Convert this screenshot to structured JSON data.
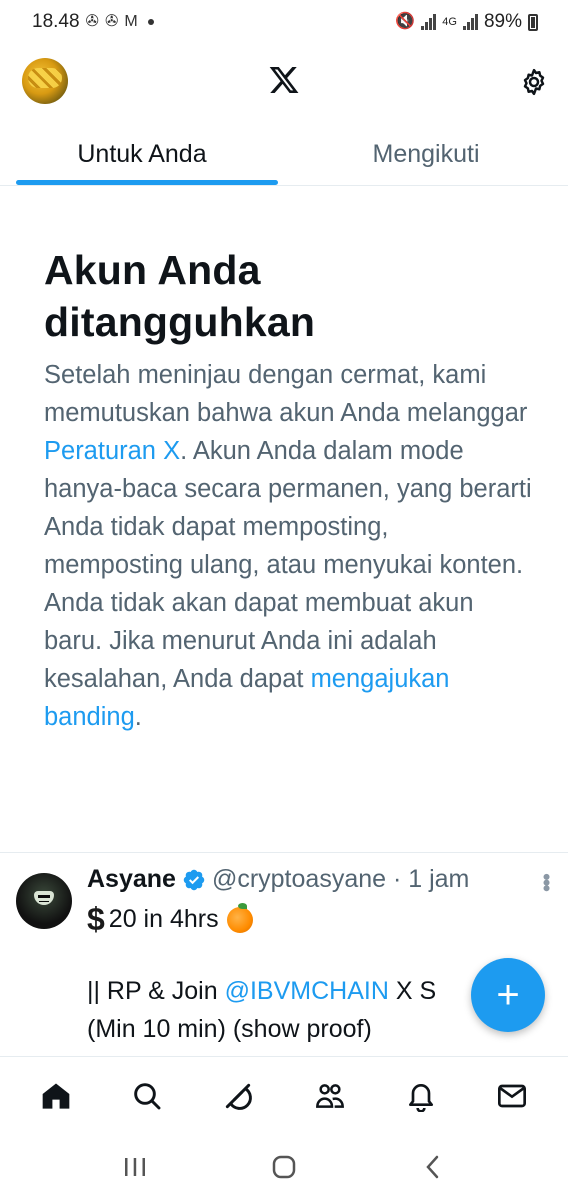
{
  "status_bar": {
    "time": "18.48",
    "battery": "89%",
    "network": "4G"
  },
  "app_bar": {
    "logo_icon": "x-logo-icon",
    "settings_icon": "gear-icon"
  },
  "tabs": [
    {
      "label": "Untuk Anda",
      "active": true
    },
    {
      "label": "Mengikuti",
      "active": false
    }
  ],
  "notice": {
    "title_line1": "Akun Anda",
    "title_line2": "ditangguhkan",
    "body_1": "Setelah meninjau dengan cermat, kami memutuskan bahwa akun Anda melanggar ",
    "link_rules": "Peraturan X",
    "body_2": ". Akun Anda dalam mode hanya-baca secara permanen, yang berarti Anda tidak dapat memposting, memposting ulang, atau menyukai konten. Anda tidak akan dapat membuat akun baru. Jika menurut Anda ini adalah kesalahan, Anda dapat ",
    "link_appeal": "mengajukan banding",
    "body_3": "."
  },
  "tweet": {
    "name": "Asyane",
    "handle_time": "@cryptoasyane · 1 jam",
    "line1_dollar": "$",
    "line1_text": "20 in 4hrs",
    "line2_prefix": "|| RP & Join ",
    "line2_mention": "@IBVMCHAIN",
    "line2_suffix": " X S",
    "line3": "(Min 10 min) (show proof)"
  },
  "fab": {
    "label": "+"
  },
  "bottom_nav": [
    "home-icon",
    "search-icon",
    "grok-icon",
    "communities-icon",
    "notifications-icon",
    "messages-icon"
  ],
  "colors": {
    "accent": "#1d9bf0",
    "text_primary": "#0f1419",
    "text_secondary": "#536471"
  }
}
